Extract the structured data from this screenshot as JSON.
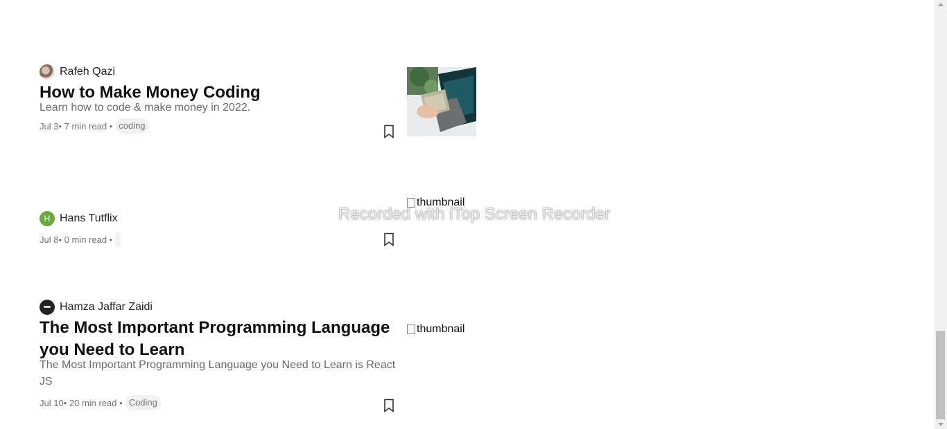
{
  "articles": [
    {
      "author": "Rafeh Qazi",
      "title": "How to Make Money Coding",
      "subtitle": "Learn how to code & make money in 2022.",
      "date": "Jul 3",
      "read_time": "• 7 min read •",
      "tag": "coding",
      "thumbnail_alt": ""
    },
    {
      "author": "Hans Tutflix",
      "avatar_letter": "H",
      "title": "",
      "subtitle": "",
      "date": "Jul 8",
      "read_time": "• 0 min read •",
      "tag": "",
      "thumbnail_alt": "thumbnail"
    },
    {
      "author": "Hamza Jaffar Zaidi",
      "title": "The Most Important Programming Language you Need to Learn",
      "subtitle": "The Most Important Programming Language you Need to Learn is React JS",
      "date": "Jul 10",
      "read_time": "• 20 min read •",
      "tag": "Coding",
      "thumbnail_alt": "thumbnail"
    }
  ],
  "watermark": "Recorded with iTop Screen Recorder",
  "icons": {
    "bookmark": "bookmark-icon",
    "broken_image": "broken-image-icon"
  }
}
